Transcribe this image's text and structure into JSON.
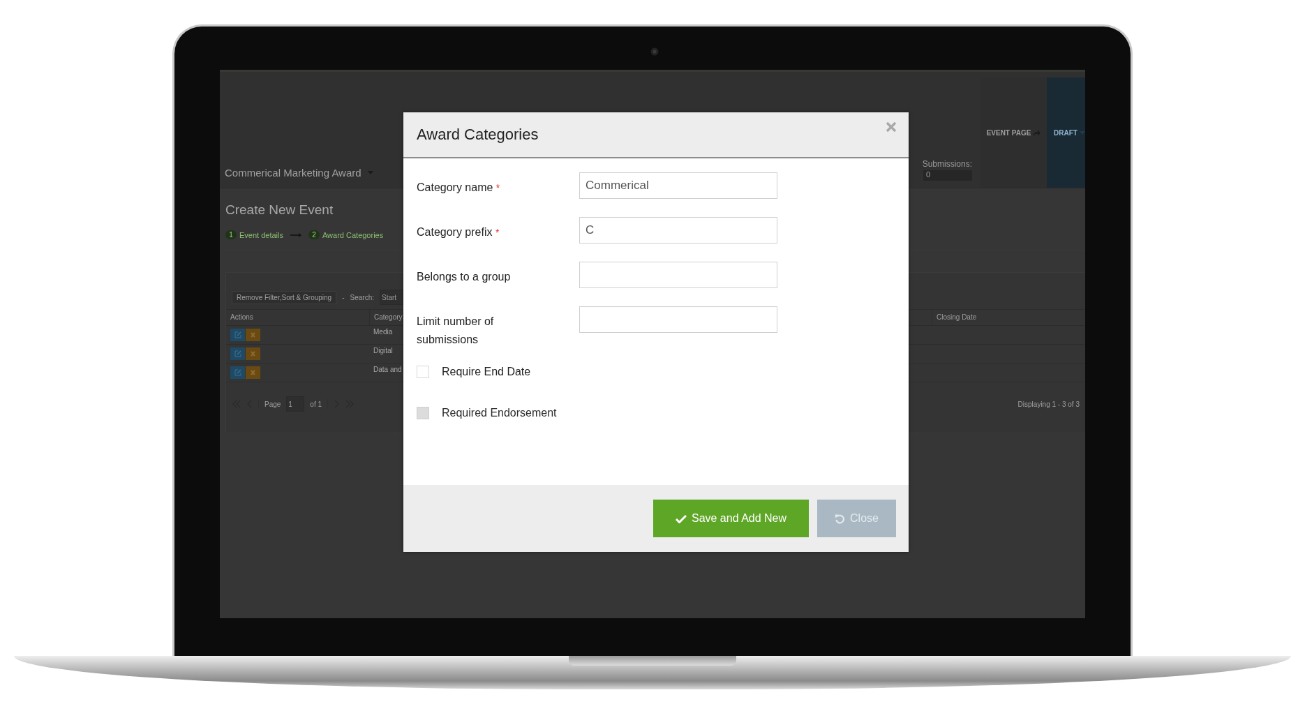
{
  "app_header": {
    "event_name": "Commerical Marketing Award",
    "submissions_label": "Submissions:",
    "submissions_value": "0",
    "event_page_button": "EVENT PAGE",
    "status_button": "DRAFT"
  },
  "page": {
    "title": "Create New Event",
    "steps": [
      {
        "number": "1",
        "label": "Event details"
      },
      {
        "number": "2",
        "label": "Award Categories"
      }
    ]
  },
  "grid": {
    "remove_filter_button": "Remove Filter,Sort & Grouping",
    "separator": "-",
    "search_label": "Search:",
    "search_placeholder": "Start",
    "columns": [
      "Actions",
      "Category",
      "Closing Date"
    ],
    "rows": [
      {
        "category": "Media"
      },
      {
        "category": "Digital"
      },
      {
        "category": "Data and"
      }
    ],
    "pagination": {
      "page_label": "Page",
      "page_value": "1",
      "of_label": "of 1",
      "summary": "Displaying 1 - 3 of 3"
    }
  },
  "dialog": {
    "title": "Award Categories",
    "fields": [
      {
        "label": "Category name",
        "required_mark": "*",
        "value": "Commerical"
      },
      {
        "label": "Category prefix",
        "required_mark": "*",
        "value": "C"
      },
      {
        "label": "Belongs to a group"
      },
      {
        "label": "Limit number of submissions"
      }
    ],
    "checkboxes": [
      {
        "label": "Require End Date",
        "checked": false,
        "disabled": false
      },
      {
        "label": "Required Endorsement",
        "checked": false,
        "disabled": true
      }
    ],
    "buttons": [
      {
        "kind": "primary",
        "label": "Save and Add New"
      },
      {
        "kind": "secondary",
        "label": "Close"
      }
    ]
  }
}
